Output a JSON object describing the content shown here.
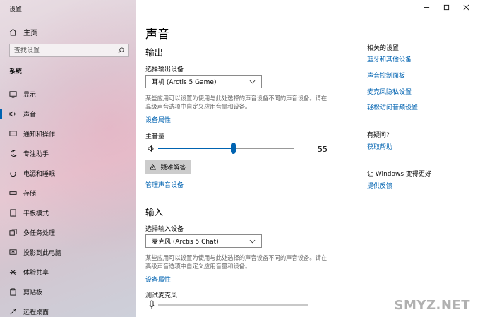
{
  "window": {
    "title": "设置"
  },
  "sidebar": {
    "home_label": "主页",
    "search_placeholder": "查找设置",
    "section_header": "系统",
    "items": [
      {
        "label": "显示",
        "icon": "display-icon"
      },
      {
        "label": "声音",
        "icon": "speaker-icon",
        "active": true
      },
      {
        "label": "通知和操作",
        "icon": "notification-icon"
      },
      {
        "label": "专注助手",
        "icon": "moon-icon"
      },
      {
        "label": "电源和睡眠",
        "icon": "power-icon"
      },
      {
        "label": "存储",
        "icon": "storage-icon"
      },
      {
        "label": "平板模式",
        "icon": "tablet-icon"
      },
      {
        "label": "多任务处理",
        "icon": "multitask-icon"
      },
      {
        "label": "投影到此电脑",
        "icon": "project-icon"
      },
      {
        "label": "体验共享",
        "icon": "share-icon"
      },
      {
        "label": "剪贴板",
        "icon": "clipboard-icon"
      },
      {
        "label": "远程桌面",
        "icon": "remote-desktop-icon"
      }
    ]
  },
  "main": {
    "title": "声音",
    "output": {
      "heading": "输出",
      "select_label": "选择输出设备",
      "device": "耳机 (Arctis 5 Game)",
      "description": "某些应用可以设置为使用与此处选择的声音设备不同的声音设备。请在高级声音选项中自定义应用音量和设备。",
      "properties_link": "设备属性",
      "volume_label": "主音量",
      "volume": 55,
      "troubleshoot_label": "疑难解答",
      "manage_link": "管理声音设备"
    },
    "input": {
      "heading": "输入",
      "select_label": "选择输入设备",
      "device": "麦克风 (Arctis 5 Chat)",
      "description": "某些应用可以设置为使用与此处选择的声音设备不同的声音设备。请在高级声音选项中自定义应用音量和设备。",
      "properties_link": "设备属性",
      "test_label": "测试麦克风",
      "mic_level": 0
    }
  },
  "related": {
    "heading": "相关的设置",
    "links": [
      "蓝牙和其他设备",
      "声音控制面板",
      "麦克风隐私设置",
      "轻松访问音频设置"
    ],
    "question_heading": "有疑问?",
    "help_link": "获取帮助",
    "improve_heading": "让 Windows 变得更好",
    "feedback_link": "提供反馈"
  },
  "watermark": "SMYZ.NET",
  "colors": {
    "accent": "#0063b1",
    "link": "#0063b1"
  }
}
